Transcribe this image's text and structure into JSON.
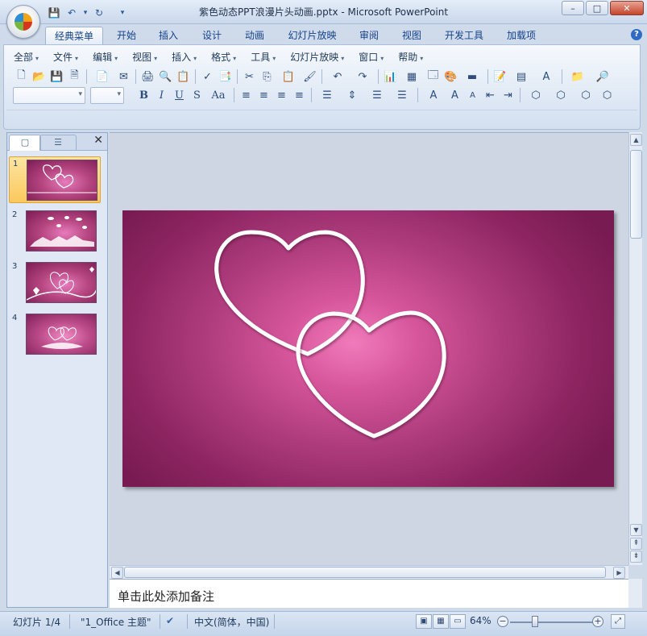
{
  "window": {
    "title": "紫色动态PPT浪漫片头动画.pptx - Microsoft PowerPoint",
    "controls": {
      "minimize": "–",
      "maximize": "□",
      "close": "✕"
    }
  },
  "qat": {
    "save_icon": "💾",
    "undo_icon": "↶",
    "redo_icon": "↻",
    "dropdown": "▾"
  },
  "ribbon_tabs": [
    "经典菜单",
    "开始",
    "插入",
    "设计",
    "动画",
    "幻灯片放映",
    "审阅",
    "视图",
    "开发工具",
    "加载项"
  ],
  "active_tab": "经典菜单",
  "help": "?",
  "menus": [
    "全部",
    "文件",
    "编辑",
    "视图",
    "插入",
    "格式",
    "工具",
    "幻灯片放映",
    "窗口",
    "帮助"
  ],
  "toolbar": {
    "row1": [
      "🗋",
      "📂",
      "💾",
      "🗎",
      "📄",
      "✉",
      "🖨",
      "🔍",
      "📋",
      "✓",
      "📑",
      "✂",
      "⎘",
      "📋",
      "🖌",
      "↶",
      "↷",
      "📊",
      "▦",
      "🗔",
      "🎨",
      "▬",
      "📝",
      "▤",
      "A",
      "📁",
      "🔎"
    ],
    "row2_fmt": [
      "B",
      "I",
      "U",
      "S",
      "Aa",
      "≡",
      "≡",
      "≡",
      "≡",
      "☰",
      "⇕",
      "☰",
      "☰",
      "A",
      "A",
      "A",
      "⇤",
      "⇥",
      "⬡",
      "⬡",
      "⬡",
      "⬡"
    ]
  },
  "left_pane": {
    "tab_slides_icon": "▢",
    "tab_outline_icon": "☰",
    "close_icon": "✕",
    "slides": [
      {
        "num": "1",
        "selected": true
      },
      {
        "num": "2",
        "selected": false
      },
      {
        "num": "3",
        "selected": false
      },
      {
        "num": "4",
        "selected": false
      }
    ]
  },
  "notes_placeholder": "单击此处添加备注",
  "status": {
    "slide_info": "幻灯片 1/4",
    "theme": "\"1_Office 主题\"",
    "language": "中文(简体，中国)",
    "zoom": "64%",
    "zoom_fraction": 0.3
  },
  "colors": {
    "slide_center": "#f07bbb",
    "slide_edge": "#781b52",
    "accent": "#15428b"
  }
}
